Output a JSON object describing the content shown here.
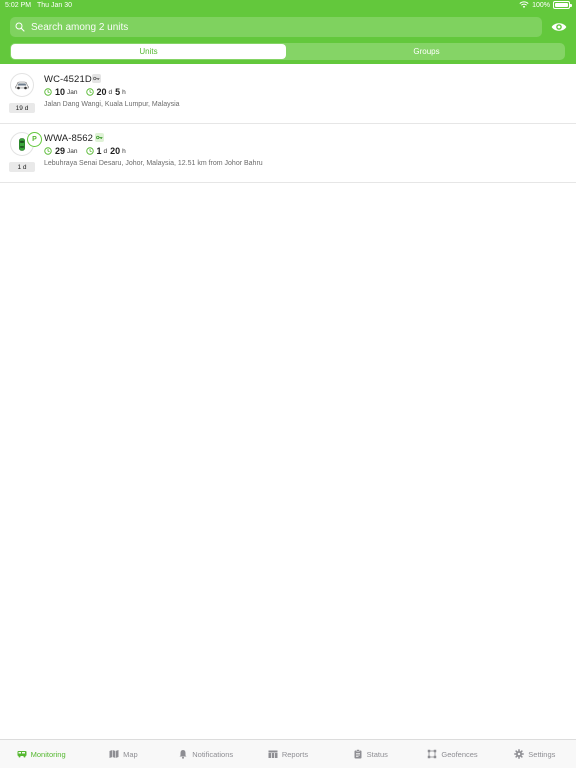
{
  "status_bar": {
    "time": "5:02 PM",
    "date": "Thu Jan 30",
    "battery": "100%",
    "battery_level": 1.0
  },
  "search": {
    "placeholder": "Search among 2 units",
    "value": ""
  },
  "segments": {
    "units": "Units",
    "groups": "Groups",
    "selected": "Units"
  },
  "units": [
    {
      "name": "WC-4521D",
      "date_num": "10",
      "date_month": "Jan",
      "duration_1_num": "20",
      "duration_1_unit": "d",
      "duration_2_num": "5",
      "duration_2_unit": "h",
      "address": "Jalan Dang Wangi, Kuala Lumpur, Malaysia",
      "age": "19 d",
      "icon": "white-car-icon"
    },
    {
      "name": "WWA-8562",
      "status_letter": "P",
      "date_num": "29",
      "date_month": "Jan",
      "duration_1_num": "1",
      "duration_1_unit": "d",
      "duration_2_num": "20",
      "duration_2_unit": "h",
      "address": "Lebuhraya Senai Desaru, Johor, Malaysia, 12.51 km from Johor Bahru",
      "age": "1 d",
      "icon": "green-car-icon"
    }
  ],
  "tabs": [
    {
      "label": "Monitoring",
      "icon": "bus-icon"
    },
    {
      "label": "Map",
      "icon": "map-icon"
    },
    {
      "label": "Notifications",
      "icon": "bell-icon"
    },
    {
      "label": "Reports",
      "icon": "reports-icon"
    },
    {
      "label": "Status",
      "icon": "clipboard-icon"
    },
    {
      "label": "Geofences",
      "icon": "geofence-icon"
    },
    {
      "label": "Settings",
      "icon": "gear-icon"
    }
  ],
  "colors": {
    "accent": "#63c83c",
    "accent_text": "#55b830",
    "inactive": "#8e8e93"
  }
}
